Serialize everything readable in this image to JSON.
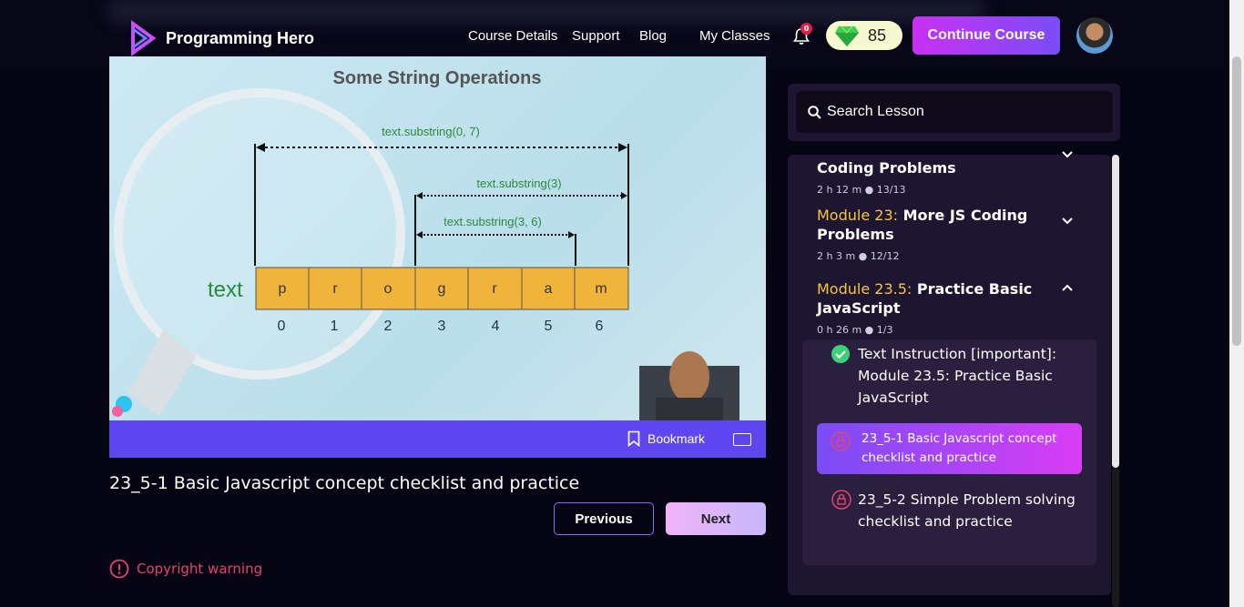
{
  "header": {
    "logo_text": "Programming Hero",
    "nav": [
      "Course Details",
      "Support",
      "Blog",
      "My Classes"
    ],
    "notification_count": "0",
    "gems": "85",
    "continue_label": "Continue Course"
  },
  "video": {
    "slide_title": "Some String Operations",
    "word_label": "text",
    "ops": [
      "text.substring(0, 7)",
      "text.substring(3)",
      "text.substring(3, 6)"
    ],
    "letters": [
      "p",
      "r",
      "o",
      "g",
      "r",
      "a",
      "m"
    ],
    "indices": [
      "0",
      "1",
      "2",
      "3",
      "4",
      "5",
      "6"
    ],
    "bookmark_label": "Bookmark"
  },
  "lesson": {
    "title": "23_5-1 Basic Javascript concept checklist and practice",
    "previous_label": "Previous",
    "next_label": "Next",
    "copyright": "Copyright warning"
  },
  "sidebar": {
    "search_placeholder": "Search Lesson",
    "modules": [
      {
        "num": "",
        "title": "Coding Problems",
        "meta": "2 h 12 m ●  13/13"
      },
      {
        "num": "Module 23:",
        "title": "More JS Coding Problems",
        "meta": "2 h 3 m ●  12/12"
      },
      {
        "num": "Module 23.5:",
        "title": "Practice Basic JavaScript",
        "meta": "0 h 26 m ●  1/3"
      }
    ],
    "lessons": [
      "Text Instruction [important]: Module 23.5: Practice Basic JavaScript",
      "23_5-1 Basic Javascript concept checklist and practice",
      "23_5-2 Simple Problem solving checklist and practice"
    ]
  },
  "colors": {
    "accent": "#7a4df6",
    "module_num": "#f5c547",
    "video_bar": "#6046f0",
    "warning": "#e8416e"
  }
}
